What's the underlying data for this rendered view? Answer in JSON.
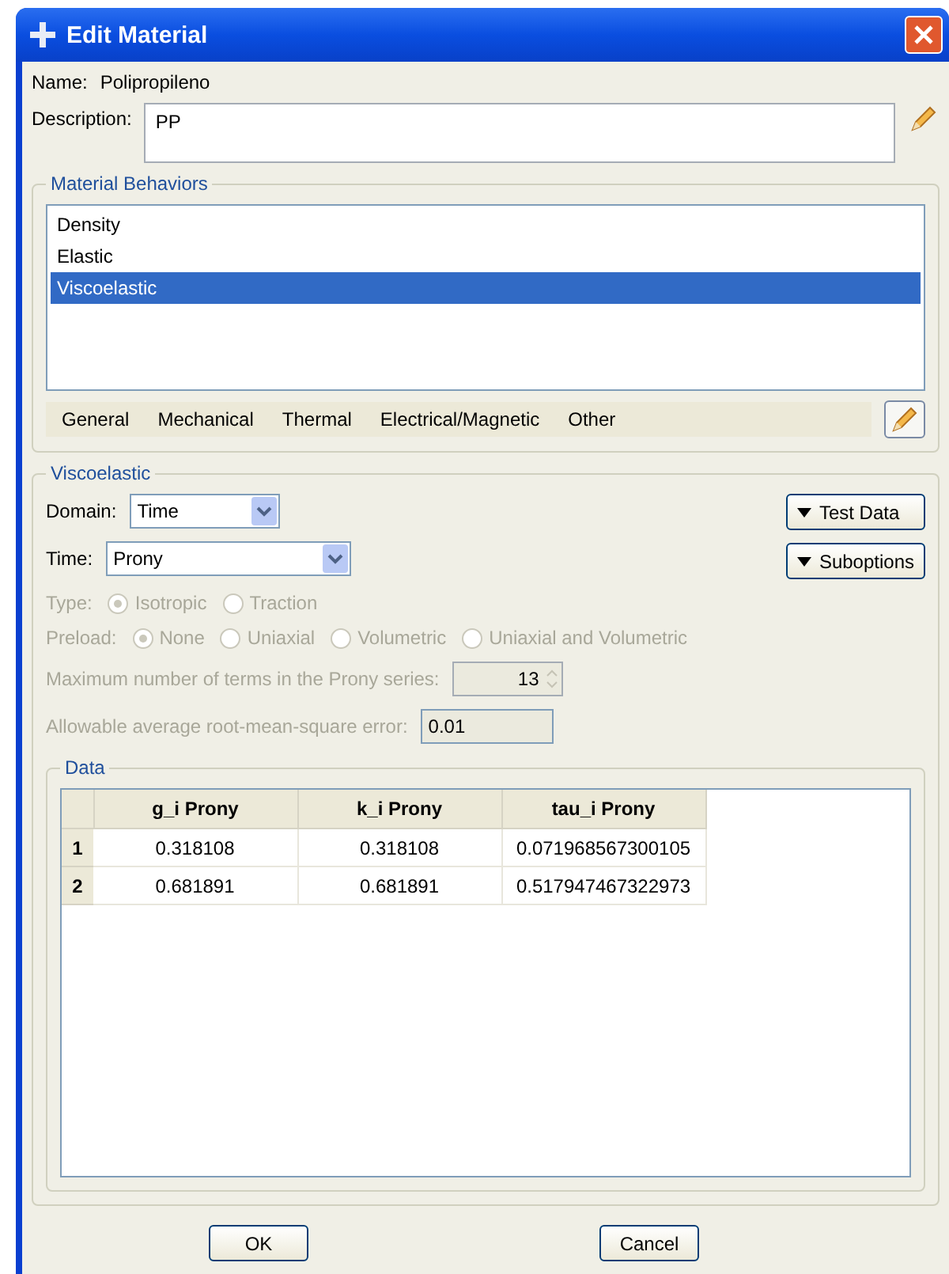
{
  "window": {
    "title": "Edit Material"
  },
  "name": {
    "label": "Name:",
    "value": "Polipropileno"
  },
  "description": {
    "label": "Description:",
    "value": "PP"
  },
  "behaviors": {
    "title": "Material Behaviors",
    "items": [
      {
        "label": "Density",
        "selected": false
      },
      {
        "label": "Elastic",
        "selected": false
      },
      {
        "label": "Viscoelastic",
        "selected": true
      }
    ],
    "menus": [
      "General",
      "Mechanical",
      "Thermal",
      "Electrical/Magnetic",
      "Other"
    ]
  },
  "viscoelastic": {
    "title": "Viscoelastic",
    "domain": {
      "label": "Domain:",
      "value": "Time"
    },
    "time": {
      "label": "Time:",
      "value": "Prony"
    },
    "buttons": [
      "Test Data",
      "Suboptions"
    ],
    "radio_groups": [
      {
        "label": "Type:",
        "disabled": true,
        "options": [
          {
            "label": "Isotropic",
            "selected": true
          },
          {
            "label": "Traction",
            "selected": false
          }
        ]
      },
      {
        "label": "Preload:",
        "disabled": true,
        "options": [
          {
            "label": "None",
            "selected": true
          },
          {
            "label": "Uniaxial",
            "selected": false
          },
          {
            "label": "Volumetric",
            "selected": false
          },
          {
            "label": "Uniaxial and Volumetric",
            "selected": false
          }
        ]
      }
    ],
    "max_terms": {
      "label": "Maximum number of terms in the Prony series:",
      "value": "13",
      "disabled": true
    },
    "rms_error": {
      "label": "Allowable average root-mean-square error:",
      "value": "0.01"
    },
    "data": {
      "title": "Data",
      "columns": [
        "g_i Prony",
        "k_i Prony",
        "tau_i Prony"
      ],
      "rows": [
        {
          "index": "1",
          "cells": [
            "0.318108",
            "0.318108",
            "0.071968567300105"
          ]
        },
        {
          "index": "2",
          "cells": [
            "0.681891",
            "0.681891",
            "0.517947467322973"
          ]
        }
      ]
    }
  },
  "footer": {
    "buttons": [
      "OK",
      "Cancel"
    ]
  }
}
